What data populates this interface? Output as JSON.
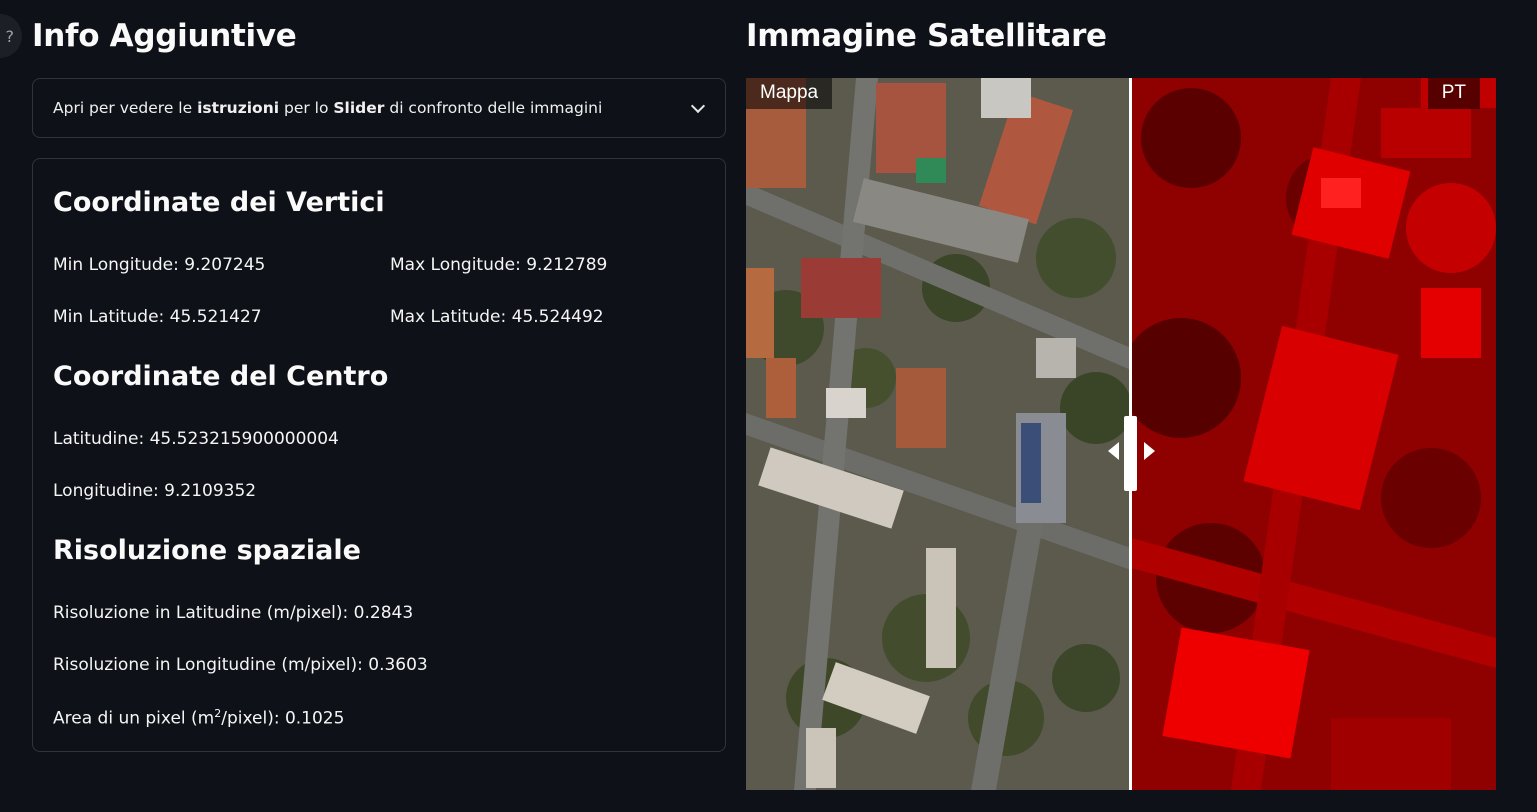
{
  "left_panel": {
    "title": "Info Aggiuntive",
    "expander": {
      "text_1": "Apri per vedere le ",
      "bold_1": "istruzioni",
      "text_2": " per lo ",
      "bold_2": "Slider",
      "text_3": " di confronto delle immagini"
    },
    "vertices": {
      "heading": "Coordinate dei Vertici",
      "min_longitude": "Min Longitude: 9.207245",
      "max_longitude": "Max Longitude: 9.212789",
      "min_latitude": "Min Latitude: 45.521427",
      "max_latitude": "Max Latitude: 45.524492"
    },
    "center": {
      "heading": "Coordinate del Centro",
      "latitude": "Latitudine: 45.523215900000004",
      "longitude": "Longitudine: 9.2109352"
    },
    "resolution": {
      "heading": "Risoluzione spaziale",
      "lat_res": "Risoluzione in Latitudine (m/pixel): 0.2843",
      "lon_res": "Risoluzione in Longitudine (m/pixel): 0.3603",
      "pixel_area_prefix": "Area di un pixel (m",
      "pixel_area_sup": "2",
      "pixel_area_suffix": "/pixel): 0.1025"
    }
  },
  "right_panel": {
    "title": "Immagine Satellitare",
    "left_label": "Mappa",
    "right_label": "PT"
  },
  "colors": {
    "background": "#0e1117",
    "border": "#31343c",
    "overlay_red": "#e00000"
  },
  "icons": [
    "help-icon",
    "chevron-down-icon",
    "arrow-left-icon",
    "arrow-right-icon"
  ]
}
